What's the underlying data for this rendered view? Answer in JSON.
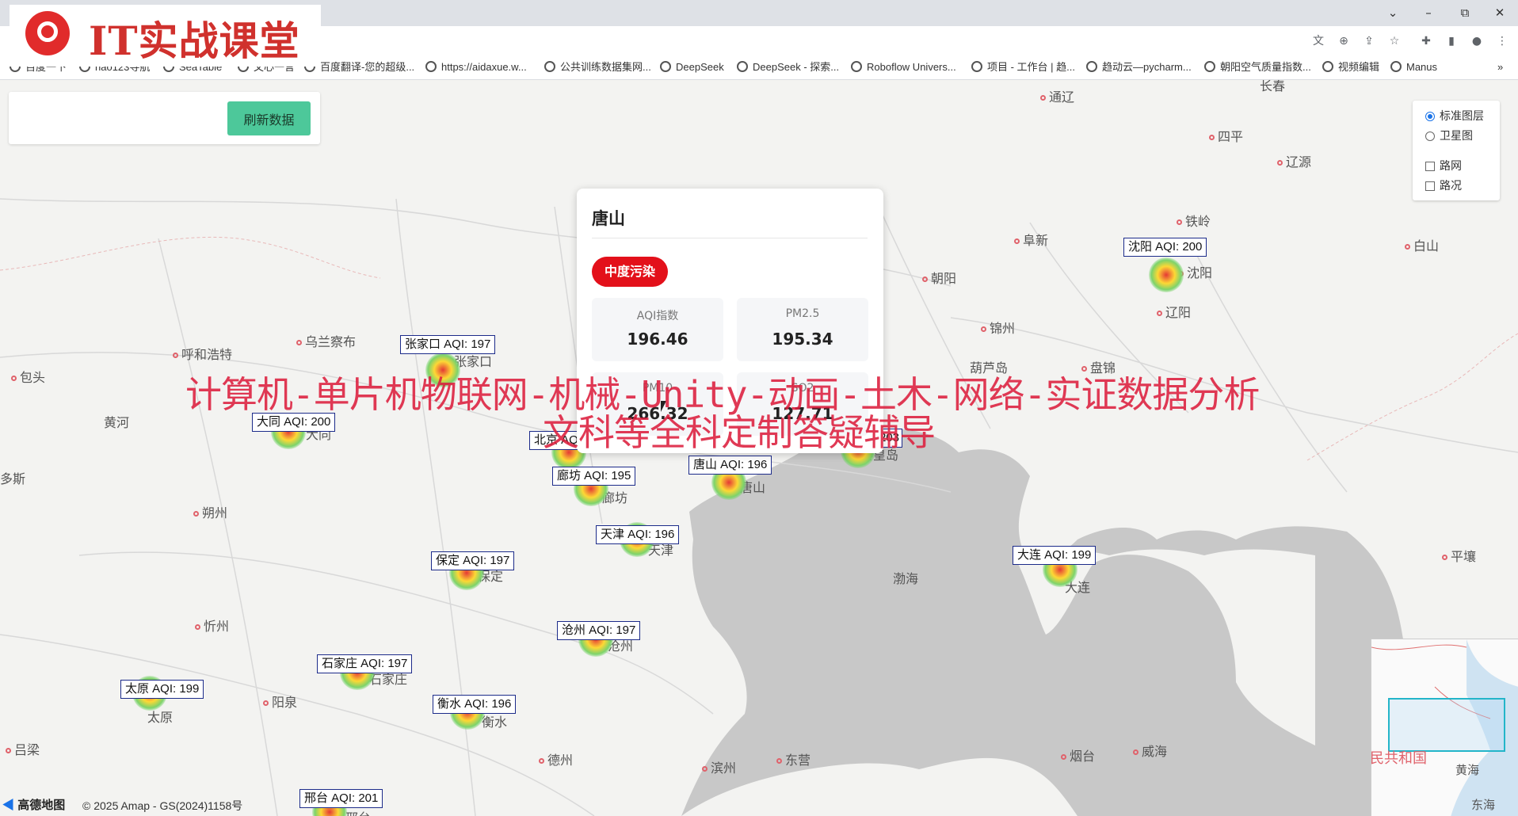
{
  "window_controls": {
    "chevron": "⌄",
    "min": "–",
    "max": "⧉",
    "close": "✕"
  },
  "toolbar_icons": [
    "translate-icon",
    "zoom-icon",
    "share-icon",
    "star-icon",
    "extensions-icon",
    "sidepanel-icon",
    "profile-icon",
    "menu-icon"
  ],
  "bookmarks": [
    "百度一下",
    "hao123导航",
    "SeaTable",
    "文心一言",
    "百度翻译-您的超级...",
    "https://aidaxue.w...",
    "公共训练数据集网...",
    "DeepSeek",
    "DeepSeek - 探索...",
    "Roboflow Univers...",
    "项目 - 工作台 | 趋...",
    "趋动云—pycharm...",
    "朝阳空气质量指数...",
    "视频编辑",
    "Manus"
  ],
  "bookmarks_more": "»",
  "logo": {
    "text": "IT实战课堂"
  },
  "refresh": {
    "label": "刷新数据"
  },
  "layers": {
    "standard": "标准图层",
    "satellite": "卫星图",
    "road": "路网",
    "traffic": "路况"
  },
  "popup": {
    "city": "唐山",
    "level": "中度污染",
    "aqi_label": "AQI指数",
    "aqi_value": "196.46",
    "pm25_label": "PM2.5",
    "pm25_value": "195.34",
    "pm10_label": "PM10",
    "pm10_value": "266.32",
    "so2_label": "SO2",
    "so2_value": "127.71"
  },
  "watermark": {
    "line1": "计算机-单片机物联网-机械-Unity-动画-土木-网络-实证数据分析",
    "line2": "文科等全科定制答疑辅导"
  },
  "aqi_labels": {
    "zhangjiakou": "张家口 AQI: 197",
    "datong": "大同 AQI: 200",
    "beijing": "北京 AQ",
    "langfang": "廊坊 AQI: 195",
    "tangshan": "唐山 AQI: 196",
    "tianjin": "天津 AQI: 196",
    "baoding": "保定 AQI: 197",
    "cangzhou": "沧州 AQI: 197",
    "shijiazhuang": "石家庄 AQI: 197",
    "taiyuan": "太原 AQI: 199",
    "hengshui": "衡水 AQI: 196",
    "xingtai": "邢台 AQI: 201",
    "shenyang": "沈阳 AQI: 200",
    "dalian": "大连 AQI: 199",
    "qinhuangdao": "203"
  },
  "places": {
    "tonghua": "通辽",
    "siping": "四平",
    "liaoyuan": "辽源",
    "tieling": "铁岭",
    "fuxin": "阜新",
    "baishan": "白山",
    "chaoyang": "朝阳",
    "shenyang": "沈阳",
    "liaoyang": "辽阳",
    "jinzhou": "锦州",
    "huludao": "葫芦岛",
    "panjin": "盘锦",
    "hohhot": "呼和浩特",
    "ulanqab": "乌兰察布",
    "baotou": "包头",
    "huanghe": "黄河",
    "ordos": "多斯",
    "shuozhou": "朔州",
    "xinzhou": "忻州",
    "yangquan": "阳泉",
    "lvliang": "吕梁",
    "dezhou": "德州",
    "binzhou": "滨州",
    "dongying": "东营",
    "yantai": "烟台",
    "weihai": "威海",
    "pyongyang": "平壤",
    "zhangjiakou_l": "张家口",
    "datong_l": "大同",
    "langfang_l": "廊坊",
    "tangshan_l": "唐山",
    "tianjin_l": "天津",
    "baoding_l": "保定",
    "cangzhou_l": "沧州",
    "shijiazhuang_l": "石家庄",
    "taiyuan_l": "太原",
    "hengshui_l": "衡水",
    "xingtai_l": "邢台",
    "dalian_l": "大连",
    "qinhuangdao_l": "秦皇岛",
    "changchun": "长春"
  },
  "seas": {
    "bohai": "渤海",
    "huanghai": "黄海",
    "donghai": "东海",
    "prc": "民共和国"
  },
  "attribution": {
    "amap": "高德地图",
    "copyright": "© 2025 Amap - GS(2024)1158号"
  }
}
